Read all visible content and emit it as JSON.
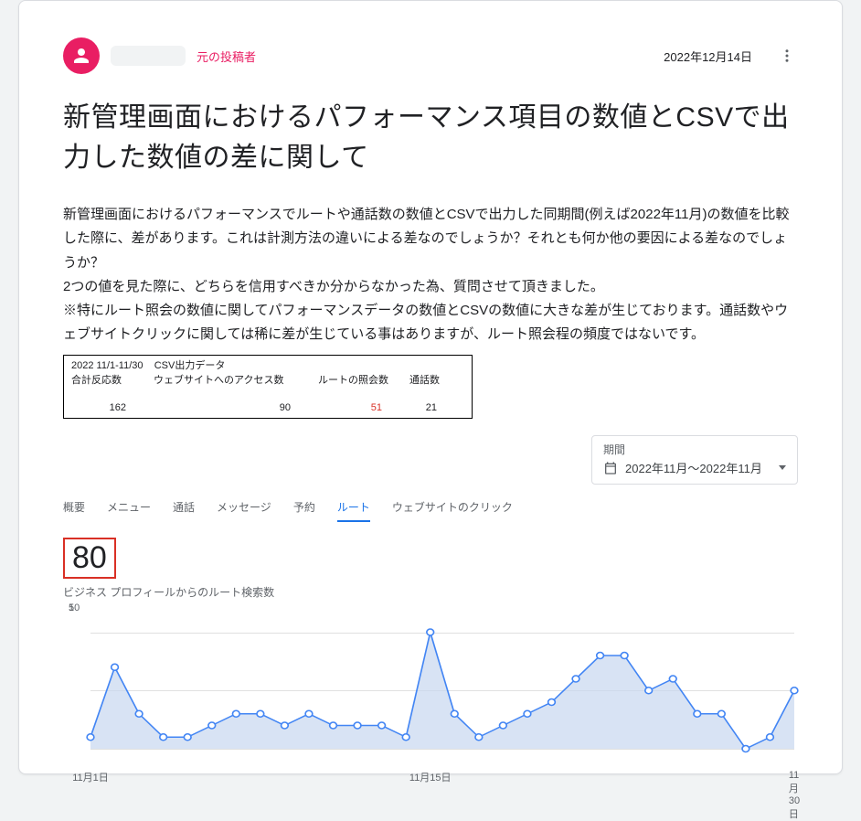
{
  "post": {
    "op_badge": "元の投稿者",
    "date": "2022年12月14日",
    "title": "新管理画面におけるパフォーマンス項目の数値とCSVで出力した数値の差に関して",
    "body_p1": "新管理画面におけるパフォーマンスでルートや通話数の数値とCSVで出力した同期間(例えば2022年11月)の数値を比較した際に、差があります。これは計測方法の違いによる差なのでしょうか？それとも何か他の要因による差なのでしょうか？",
    "body_p2": "2つの値を見た際に、どちらを信用すべきか分からなかった為、質問させて頂きました。",
    "body_p3": "※特にルート照会の数値に関してパフォーマンスデータの数値とCSVの数値に大きな差が生じております。通話数やウェブサイトクリックに関しては稀に差が生じている事はありますが、ルート照会程の頻度ではないです。"
  },
  "csv": {
    "range": "2022 11/1-11/30",
    "title": "CSV出力データ",
    "cols": [
      "合計反応数",
      "ウェブサイトへのアクセス数",
      "ルートの照会数",
      "通話数"
    ],
    "values": [
      162,
      90,
      51,
      21
    ],
    "highlight_index": 2
  },
  "range_picker": {
    "label": "期間",
    "value": "2022年11月～2022年11月"
  },
  "tabs": {
    "items": [
      "概要",
      "メニュー",
      "通話",
      "メッセージ",
      "予約",
      "ルート",
      "ウェブサイトのクリック"
    ],
    "active_index": 5
  },
  "metric": {
    "big": "80",
    "subtitle": "ビジネス プロフィールからのルート検索数"
  },
  "chart_data": {
    "type": "line",
    "title": "ビジネス プロフィールからのルート検索数",
    "xlabel": "",
    "ylabel": "",
    "ylim": [
      0,
      12
    ],
    "yticks": [
      5,
      10
    ],
    "x": [
      "11月1日",
      "11月2日",
      "11月3日",
      "11月4日",
      "11月5日",
      "11月6日",
      "11月7日",
      "11月8日",
      "11月9日",
      "11月10日",
      "11月11日",
      "11月12日",
      "11月13日",
      "11月14日",
      "11月15日",
      "11月16日",
      "11月17日",
      "11月18日",
      "11月19日",
      "11月20日",
      "11月21日",
      "11月22日",
      "11月23日",
      "11月24日",
      "11月25日",
      "11月26日",
      "11月27日",
      "11月28日",
      "11月29日",
      "11月30日"
    ],
    "xticks": [
      "11月1日",
      "11月15日",
      "11月30日"
    ],
    "values": [
      1,
      7,
      3,
      1,
      1,
      2,
      3,
      3,
      2,
      3,
      2,
      2,
      2,
      1,
      10,
      3,
      1,
      2,
      3,
      4,
      6,
      8,
      8,
      5,
      6,
      3,
      3,
      0,
      1,
      5
    ],
    "fill_color": "#c8d7f0",
    "line_color": "#4285f4"
  }
}
